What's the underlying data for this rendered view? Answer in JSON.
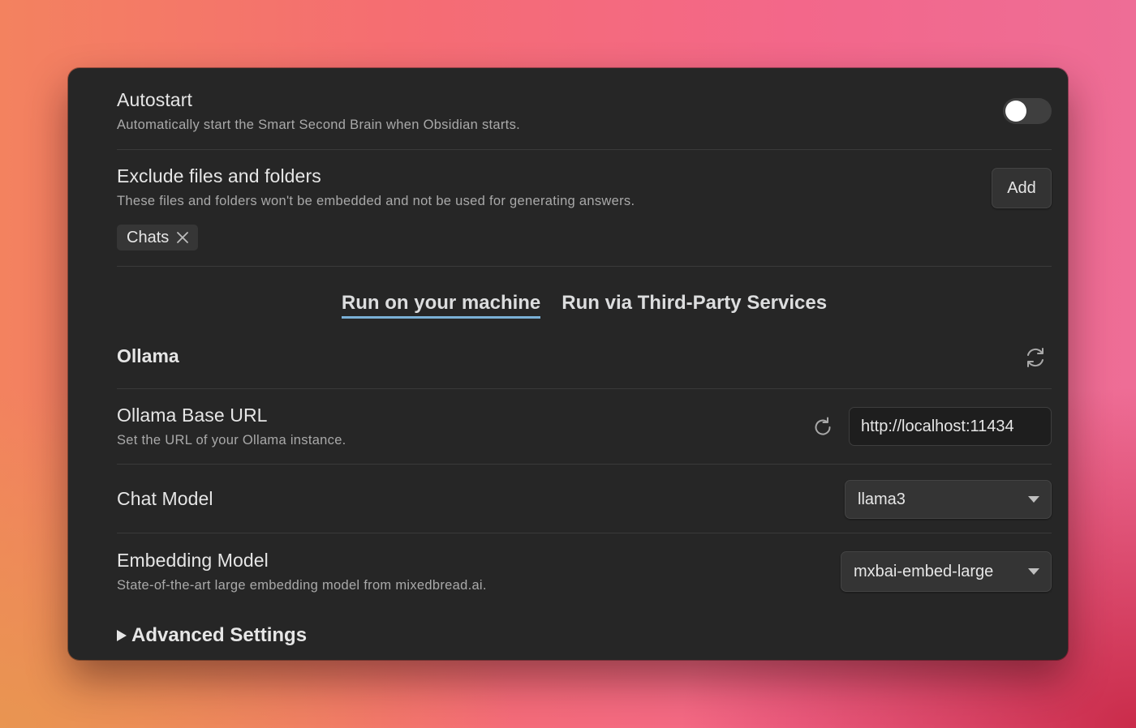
{
  "autostart": {
    "title": "Autostart",
    "description": "Automatically start the Smart Second Brain when Obsidian starts.",
    "enabled": false
  },
  "exclude": {
    "title": "Exclude files and folders",
    "description": "These files and folders won't be embedded and not be used for generating answers.",
    "add_label": "Add",
    "chips": [
      "Chats"
    ]
  },
  "tabs": [
    {
      "label": "Run on your machine",
      "active": true
    },
    {
      "label": "Run via Third-Party Services",
      "active": false
    }
  ],
  "ollama": {
    "heading": "Ollama",
    "base_url": {
      "title": "Ollama Base URL",
      "description": "Set the URL of your Ollama instance.",
      "value": "http://localhost:11434"
    },
    "chat_model": {
      "title": "Chat Model",
      "value": "llama3"
    },
    "embedding_model": {
      "title": "Embedding Model",
      "description": "State-of-the-art large embedding model from mixedbread.ai.",
      "value": "mxbai-embed-large"
    }
  },
  "advanced": {
    "label": "Advanced Settings"
  },
  "colors": {
    "panel_bg": "#262626",
    "accent_underline": "#7ab0d6",
    "text": "#e6e6e6",
    "muted": "#a9a9a9"
  }
}
